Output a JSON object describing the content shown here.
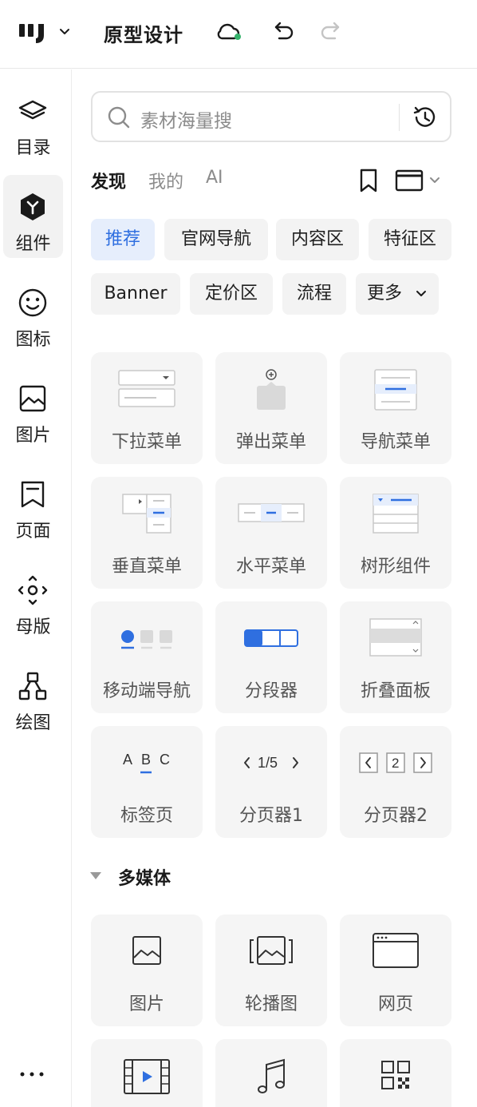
{
  "header": {
    "title": "原型设计",
    "icons": [
      "logo-icon",
      "chevron-down-icon",
      "cloud-sync-icon",
      "undo-icon",
      "redo-icon"
    ],
    "sync_status_color": "#35b26b"
  },
  "sidebar": {
    "items": [
      {
        "label": "目录",
        "icon": "layers-icon"
      },
      {
        "label": "组件",
        "icon": "component-icon"
      },
      {
        "label": "图标",
        "icon": "smiley-icon"
      },
      {
        "label": "图片",
        "icon": "image-icon"
      },
      {
        "label": "页面",
        "icon": "page-icon"
      },
      {
        "label": "母版",
        "icon": "master-icon"
      },
      {
        "label": "绘图",
        "icon": "draw-icon"
      }
    ],
    "active": "组件",
    "more": "more-icon"
  },
  "search": {
    "placeholder": "素材海量搜",
    "history_icon": "history-icon"
  },
  "tabs": [
    {
      "label": "发现",
      "active": true
    },
    {
      "label": "我的",
      "active": false
    },
    {
      "label": "AI",
      "active": false
    }
  ],
  "chips": [
    {
      "label": "推荐",
      "active": true
    },
    {
      "label": "官网导航",
      "active": false
    },
    {
      "label": "内容区",
      "active": false
    },
    {
      "label": "特征区",
      "active": false
    },
    {
      "label": "Banner",
      "active": false
    },
    {
      "label": "定价区",
      "active": false
    },
    {
      "label": "流程",
      "active": false
    },
    {
      "label": "更多",
      "active": false
    }
  ],
  "components": [
    {
      "label": "下拉菜单",
      "icon": "dropdown-menu-icon"
    },
    {
      "label": "弹出菜单",
      "icon": "popup-menu-icon"
    },
    {
      "label": "导航菜单",
      "icon": "nav-menu-icon"
    },
    {
      "label": "垂直菜单",
      "icon": "vertical-menu-icon"
    },
    {
      "label": "水平菜单",
      "icon": "horizontal-menu-icon"
    },
    {
      "label": "树形组件",
      "icon": "tree-icon"
    },
    {
      "label": "移动端导航",
      "icon": "mobile-nav-icon"
    },
    {
      "label": "分段器",
      "icon": "segmented-icon"
    },
    {
      "label": "折叠面板",
      "icon": "collapse-panel-icon"
    },
    {
      "label": "标签页",
      "icon": "tabs-icon",
      "illus_text": [
        "A",
        "B",
        "C"
      ]
    },
    {
      "label": "分页器1",
      "icon": "pagination-icon",
      "illus_text": "1/5"
    },
    {
      "label": "分页器2",
      "icon": "pagination2-icon",
      "illus_text": "2"
    }
  ],
  "media_section": {
    "title": "多媒体",
    "items": [
      {
        "label": "图片",
        "icon": "image-icon"
      },
      {
        "label": "轮播图",
        "icon": "carousel-icon"
      },
      {
        "label": "网页",
        "icon": "webpage-icon"
      },
      {
        "label": "",
        "icon": "video-icon"
      },
      {
        "label": "",
        "icon": "music-icon"
      },
      {
        "label": "",
        "icon": "qrcode-icon"
      }
    ]
  },
  "colors": {
    "accent": "#2f6fe0",
    "chip_active_bg": "#e6eefc",
    "card_bg": "#f5f5f5"
  }
}
